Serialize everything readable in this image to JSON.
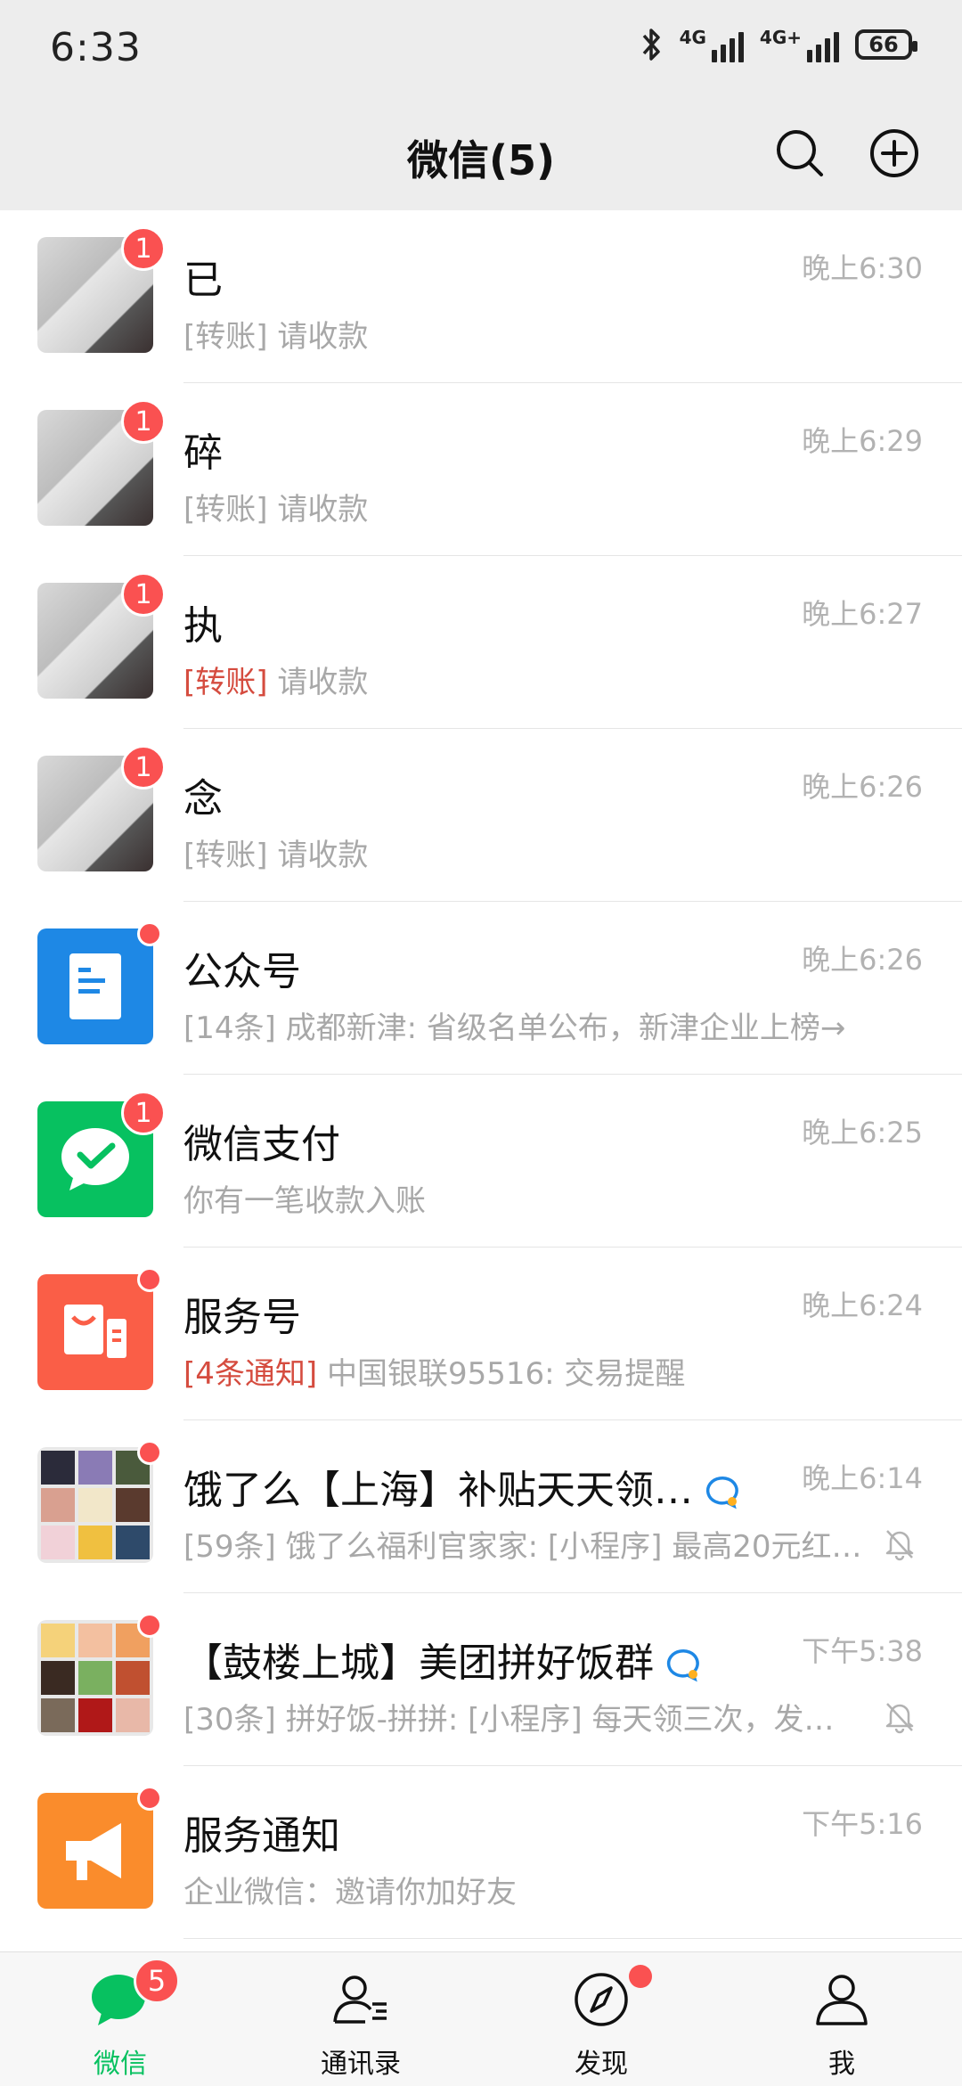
{
  "status_bar": {
    "time": "6:33",
    "network1": "4G",
    "network2": "4G+",
    "battery": "66"
  },
  "header": {
    "title": "微信(5)"
  },
  "chats": [
    {
      "name": "已",
      "time": "晚上6:30",
      "tag": "[转账]",
      "tag_red": false,
      "preview": " 请收款",
      "badge": "1"
    },
    {
      "name": "碎",
      "time": "晚上6:29",
      "tag": "[转账]",
      "tag_red": false,
      "preview": " 请收款",
      "badge": "1"
    },
    {
      "name": "执",
      "time": "晚上6:27",
      "tag": "[转账]",
      "tag_red": true,
      "preview": " 请收款",
      "badge": "1"
    },
    {
      "name": "念",
      "time": "晚上6:26",
      "tag": "[转账]",
      "tag_red": false,
      "preview": " 请收款",
      "badge": "1"
    },
    {
      "name": "公众号",
      "time": "晚上6:26",
      "tag": "[14条]",
      "tag_red": false,
      "preview": " 成都新津: 省级名单公布，新津企业上榜→"
    },
    {
      "name": "微信支付",
      "time": "晚上6:25",
      "tag": "",
      "tag_red": false,
      "preview": "你有一笔收款入账",
      "badge": "1"
    },
    {
      "name": "服务号",
      "time": "晚上6:24",
      "tag": "[4条通知]",
      "tag_red": true,
      "preview": " 中国银联95516: 交易提醒"
    },
    {
      "name": "饿了么【上海】补贴天天领…",
      "time": "晚上6:14",
      "tag": "[59条]",
      "tag_red": false,
      "preview": " 饿了么福利官家家: [小程序] 最高20元红…"
    },
    {
      "name": "【鼓楼上城】美团拼好饭群",
      "time": "下午5:38",
      "tag": "[30条]",
      "tag_red": false,
      "preview": " 拼好饭-拼拼: [小程序] 每天领三次，发…"
    },
    {
      "name": "服务通知",
      "time": "下午5:16",
      "tag": "",
      "tag_red": false,
      "preview": "企业微信：邀请你加好友"
    }
  ],
  "tabs": [
    {
      "label": "微信",
      "badge": "5"
    },
    {
      "label": "通讯录"
    },
    {
      "label": "发现"
    },
    {
      "label": "我"
    }
  ],
  "colors": {
    "accent": "#07c160",
    "badge": "#fa5151",
    "header_bg": "#ededed"
  }
}
